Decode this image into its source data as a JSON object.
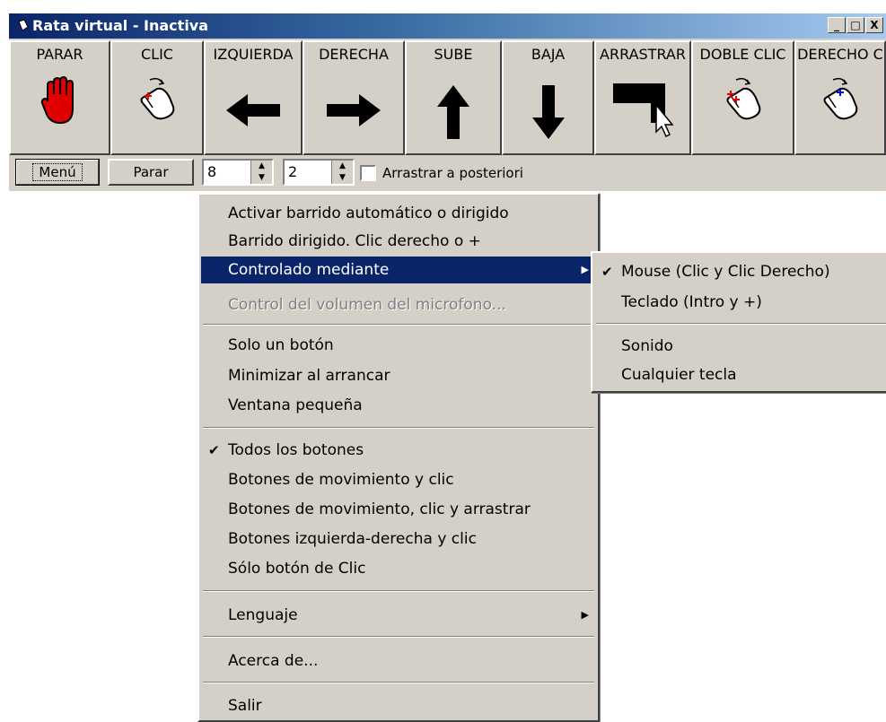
{
  "window": {
    "title": "Rata virtual - Inactiva"
  },
  "titlebar_buttons": {
    "minimize": "_",
    "maximize": "□",
    "close": "X"
  },
  "toolbar": {
    "buttons": [
      {
        "label": "PARAR",
        "icon": "stop-hand-icon"
      },
      {
        "label": "CLIC",
        "icon": "mouse-click-icon"
      },
      {
        "label": "IZQUIERDA",
        "icon": "arrow-left-icon"
      },
      {
        "label": "DERECHA",
        "icon": "arrow-right-icon"
      },
      {
        "label": "SUBE",
        "icon": "arrow-up-icon"
      },
      {
        "label": "BAJA",
        "icon": "arrow-down-icon"
      },
      {
        "label": "ARRASTRAR",
        "icon": "drag-icon"
      },
      {
        "label": "DOBLE CLIC",
        "icon": "mouse-double-click-icon"
      },
      {
        "label": "DERECHO C",
        "icon": "mouse-right-click-icon"
      }
    ]
  },
  "controls": {
    "menu_label": "Menú",
    "stop_label": "Parar",
    "spin1": "8",
    "spin2": "2",
    "drag_after_label": "Arrastrar a posteriori"
  },
  "main_menu": {
    "items": [
      "Activar barrido automático o dirigido",
      "Barrido dirigido. Clic derecho o +",
      "Controlado mediante",
      "Control del volumen del microfono...",
      "Solo un botón",
      "Minimizar al arrancar",
      "Ventana pequeña",
      "Todos los botones",
      "Botones de movimiento y clic",
      "Botones de movimiento, clic y arrastrar",
      "Botones izquierda-derecha y clic",
      "Sólo botón de Clic",
      "Lenguaje",
      "Acerca de...",
      "Salir"
    ]
  },
  "submenu": {
    "items": [
      "Mouse (Clic y Clic Derecho)",
      "Teclado (Intro y +)",
      "Sonido",
      "Cualquier tecla"
    ]
  },
  "colors": {
    "face": "#d4d0c8",
    "highlight": "#0a246a",
    "title_start": "#0a246a",
    "title_end": "#a6caf0"
  }
}
